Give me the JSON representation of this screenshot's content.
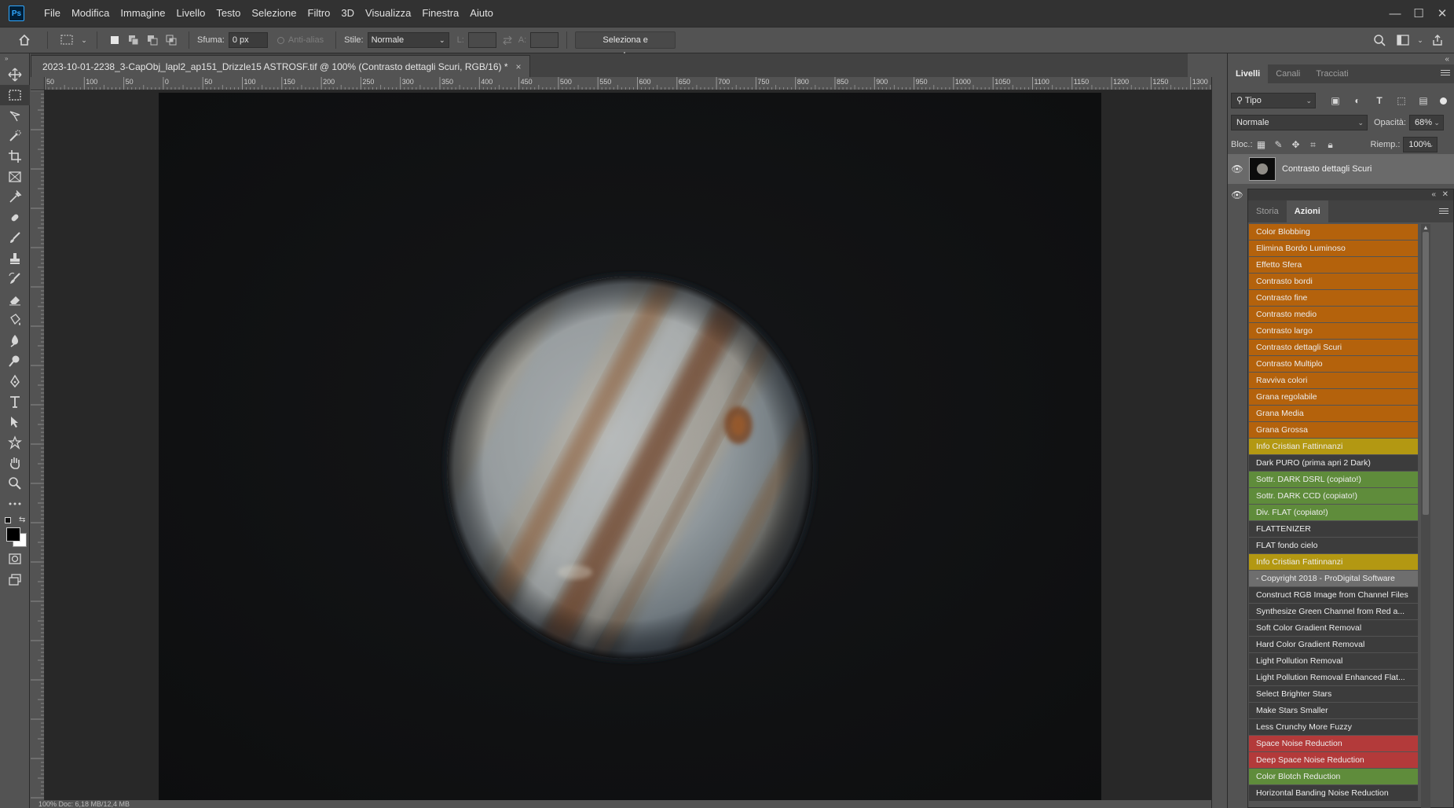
{
  "app": {
    "logo": "Ps"
  },
  "menu": [
    "File",
    "Modifica",
    "Immagine",
    "Livello",
    "Testo",
    "Selezione",
    "Filtro",
    "3D",
    "Visualizza",
    "Finestra",
    "Aiuto"
  ],
  "window_controls": {
    "minimize": "—",
    "maximize": "☐",
    "close": "✕"
  },
  "options": {
    "sfuma_label": "Sfuma:",
    "sfuma_value": "0 px",
    "antialias_label": "Anti-alias",
    "stile_label": "Stile:",
    "stile_value": "Normale",
    "l_label": "L:",
    "a_label": "A:",
    "mask_button": "Seleziona e maschera..."
  },
  "document": {
    "tab_title": "2023-10-01-2238_3-CapObj_lapl2_ap151_Drizzle15 ASTROSF.tif @ 100% (Contrasto dettagli Scuri, RGB/16) *",
    "close": "×",
    "ruler_top": [
      "50",
      "100",
      "50",
      "0",
      "50",
      "100",
      "150",
      "200",
      "250",
      "300",
      "350",
      "400",
      "450",
      "500",
      "550",
      "600",
      "650",
      "700",
      "750",
      "800",
      "850",
      "900",
      "950",
      "1000",
      "1050",
      "1100",
      "1150",
      "1200",
      "1250",
      "1300"
    ],
    "status": "100%      Doc: 6,18 MB/12,4 MB"
  },
  "layers_panel": {
    "tabs": [
      "Livelli",
      "Canali",
      "Tracciati"
    ],
    "filter_value": "Tipo",
    "blend_mode": "Normale",
    "opacity_label": "Opacità:",
    "opacity_value": "68%",
    "lock_label": "Bloc.:",
    "fill_label": "Riemp.:",
    "fill_value": "100%",
    "layer_name": "Contrasto dettagli Scuri"
  },
  "actions_panel": {
    "tabs": [
      "Storia",
      "Azioni"
    ],
    "items": [
      {
        "label": "Color Blobbing",
        "color": "#b4620c"
      },
      {
        "label": "Elimina Bordo Luminoso",
        "color": "#b4620c"
      },
      {
        "label": "Effetto Sfera",
        "color": "#b4620c"
      },
      {
        "label": "Contrasto bordi",
        "color": "#b4620c"
      },
      {
        "label": "Contrasto fine",
        "color": "#b4620c"
      },
      {
        "label": "Contrasto medio",
        "color": "#b4620c"
      },
      {
        "label": "Contrasto largo",
        "color": "#b4620c"
      },
      {
        "label": "Contrasto dettagli Scuri",
        "color": "#b4620c"
      },
      {
        "label": "Contrasto Multiplo",
        "color": "#b4620c"
      },
      {
        "label": "Ravviva colori",
        "color": "#b4620c"
      },
      {
        "label": "Grana regolabile",
        "color": "#b4620c"
      },
      {
        "label": "Grana Media",
        "color": "#b4620c"
      },
      {
        "label": "Grana Grossa",
        "color": "#b4620c"
      },
      {
        "label": "Info Cristian Fattinnanzi",
        "color": "#b39812"
      },
      {
        "label": "Dark PURO (prima apri 2 Dark)",
        "color": "#3c3c3c"
      },
      {
        "label": "Sottr. DARK DSRL (copiato!)",
        "color": "#5f8c3b"
      },
      {
        "label": "Sottr. DARK CCD (copiato!)",
        "color": "#5f8c3b"
      },
      {
        "label": "Div. FLAT (copiato!)",
        "color": "#5f8c3b"
      },
      {
        "label": "FLATTENIZER",
        "color": "#3c3c3c"
      },
      {
        "label": "FLAT fondo cielo",
        "color": "#3c3c3c"
      },
      {
        "label": "Info Cristian Fattinnanzi",
        "color": "#b39812"
      },
      {
        "label": "- Copyright 2018 - ProDigital Software",
        "color": "#6e6e6e"
      },
      {
        "label": "Construct RGB Image from Channel Files",
        "color": "#3c3c3c"
      },
      {
        "label": "Synthesize Green Channel from Red a...",
        "color": "#3c3c3c"
      },
      {
        "label": "Soft Color Gradient Removal",
        "color": "#3c3c3c"
      },
      {
        "label": "Hard Color Gradient Removal",
        "color": "#3c3c3c"
      },
      {
        "label": "Light Pollution Removal",
        "color": "#3c3c3c"
      },
      {
        "label": "Light Pollution Removal Enhanced Flat...",
        "color": "#3c3c3c"
      },
      {
        "label": "Select Brighter Stars",
        "color": "#3c3c3c"
      },
      {
        "label": "Make Stars Smaller",
        "color": "#3c3c3c"
      },
      {
        "label": "Less Crunchy More Fuzzy",
        "color": "#3c3c3c"
      },
      {
        "label": "Space Noise Reduction",
        "color": "#b33a3a"
      },
      {
        "label": "Deep Space Noise Reduction",
        "color": "#b33a3a"
      },
      {
        "label": "Color Blotch Reduction",
        "color": "#5f8c3b"
      },
      {
        "label": "Horizontal Banding Noise Reduction",
        "color": "#3c3c3c"
      }
    ]
  }
}
